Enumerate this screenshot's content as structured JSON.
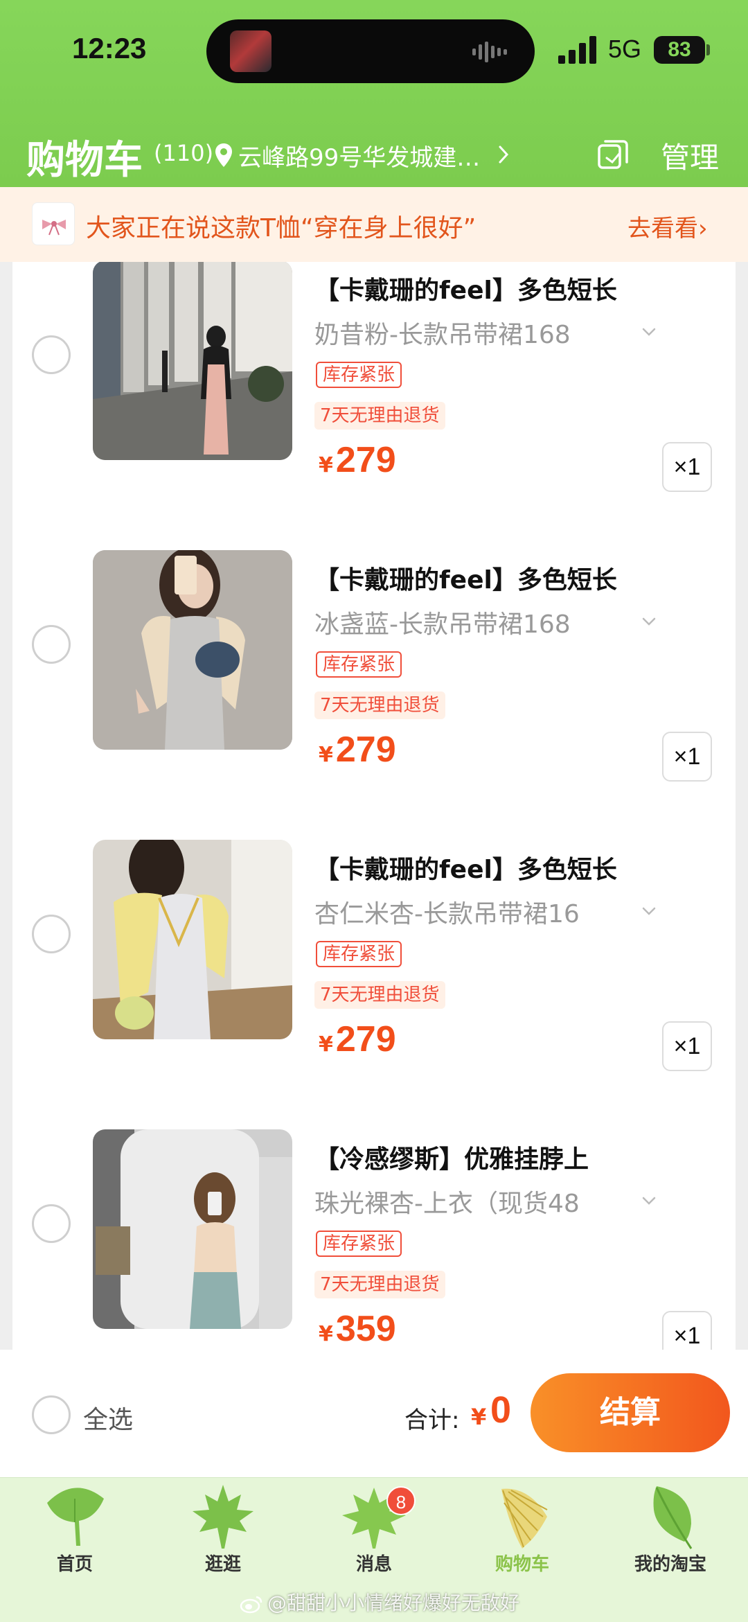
{
  "status_bar": {
    "time": "12:23",
    "network": "5G",
    "battery": "83"
  },
  "header": {
    "title": "购物车",
    "count": "(110)",
    "address": "云峰路99号华发城建…",
    "manage_label": "管理"
  },
  "banner": {
    "text": "大家正在说这款T恤“穿在身上很好”",
    "link": "去看看›"
  },
  "items": [
    {
      "title": "【卡戴珊的feel】多色短长",
      "sku": "奶昔粉-长款吊带裙168",
      "tag_stock": "库存紧张",
      "tag_return": "7天无理由退货",
      "currency": "¥",
      "price": "279",
      "qty": "×1"
    },
    {
      "title": "【卡戴珊的feel】多色短长",
      "sku": "冰盏蓝-长款吊带裙168",
      "tag_stock": "库存紧张",
      "tag_return": "7天无理由退货",
      "currency": "¥",
      "price": "279",
      "qty": "×1"
    },
    {
      "title": "【卡戴珊的feel】多色短长",
      "sku": "杏仁米杏-长款吊带裙16",
      "tag_stock": "库存紧张",
      "tag_return": "7天无理由退货",
      "currency": "¥",
      "price": "279",
      "qty": "×1"
    },
    {
      "title": "【冷感缪斯】优雅挂脖上",
      "sku": "珠光裸杏-上衣（现货48",
      "tag_stock": "库存紧张",
      "tag_return": "7天无理由退货",
      "currency": "¥",
      "price": "359",
      "qty": "×1"
    }
  ],
  "summary": {
    "select_all": "全选",
    "total_label": "合计:",
    "currency": "¥",
    "total": "0",
    "checkout": "结算"
  },
  "tabs": [
    {
      "label": "首页",
      "icon": "ginkgo-leaf-icon"
    },
    {
      "label": "逛逛",
      "icon": "maple-leaf-icon"
    },
    {
      "label": "消息",
      "icon": "maple-leaf-icon",
      "badge": "8"
    },
    {
      "label": "购物车",
      "icon": "palm-leaf-icon",
      "active": true
    },
    {
      "label": "我的淘宝",
      "icon": "leaf-icon"
    }
  ],
  "watermark": "@甜甜小小情绪好爆好无敌好",
  "colors": {
    "brand_green": "#7ccc4e",
    "price_orange": "#f24e1a",
    "checkout_gradient": [
      "#f99028",
      "#f2571d"
    ]
  }
}
